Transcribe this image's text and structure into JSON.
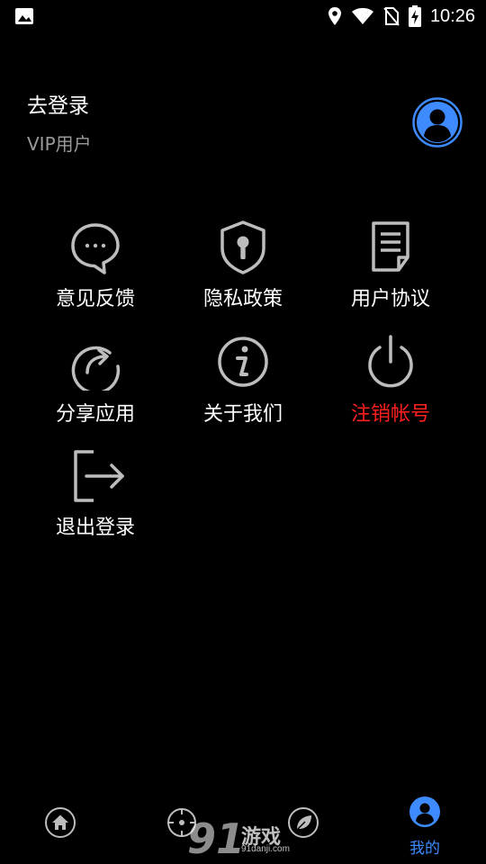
{
  "status_bar": {
    "time": "10:26",
    "icons": [
      "image-icon",
      "location-icon",
      "wifi-icon",
      "no-sim-icon",
      "battery-charging-icon"
    ]
  },
  "header": {
    "login_title": "去登录",
    "vip_label": "VIP用户",
    "avatar_icon": "user-avatar-icon"
  },
  "menu": {
    "items": [
      {
        "label": "意见反馈",
        "icon": "feedback-chat-icon"
      },
      {
        "label": "隐私政策",
        "icon": "privacy-shield-icon"
      },
      {
        "label": "用户协议",
        "icon": "agreement-document-icon"
      },
      {
        "label": "分享应用",
        "icon": "share-icon"
      },
      {
        "label": "关于我们",
        "icon": "info-icon"
      },
      {
        "label": "注销帐号",
        "icon": "power-icon",
        "color": "#ff1f1f"
      },
      {
        "label": "退出登录",
        "icon": "logout-icon"
      }
    ]
  },
  "bottom_nav": {
    "items": [
      {
        "label": "",
        "icon": "home-icon"
      },
      {
        "label": "",
        "icon": "target-icon"
      },
      {
        "label": "",
        "icon": "leaf-icon"
      },
      {
        "label": "我的",
        "icon": "profile-icon",
        "active": true
      }
    ],
    "active_color": "#3d8bff"
  },
  "watermark": {
    "logo_text": "91",
    "text": "游戏",
    "sub": "91danji.com"
  },
  "colors": {
    "background": "#000000",
    "accent": "#3d8bff",
    "danger": "#ff1f1f",
    "icon_gray": "#bdbdbd"
  }
}
